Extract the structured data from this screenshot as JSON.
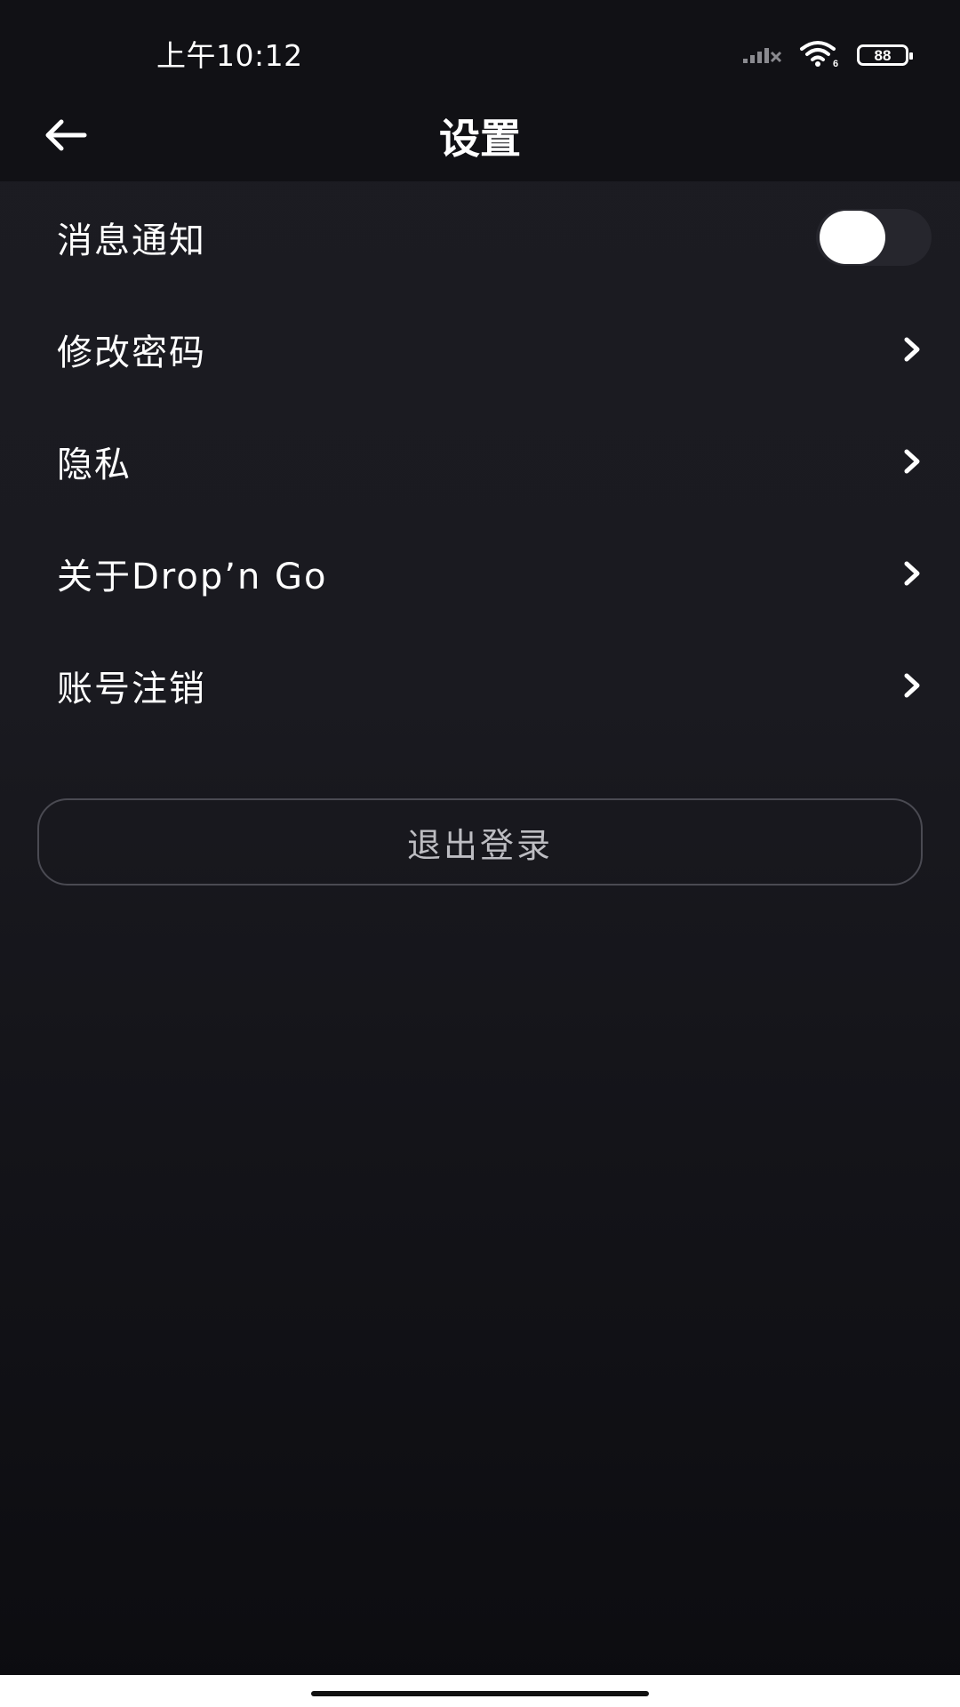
{
  "status_bar": {
    "time": "上午10:12",
    "battery": "88",
    "icons": [
      "signal-icon",
      "wifi-icon",
      "battery-icon"
    ]
  },
  "header": {
    "title": "设置",
    "back_icon": "arrow-left-icon"
  },
  "settings": {
    "items": [
      {
        "label": "消息通知",
        "control": "toggle",
        "enabled": false
      },
      {
        "label": "修改密码",
        "control": "chevron"
      },
      {
        "label": "隐私",
        "control": "chevron"
      },
      {
        "label": "关于Drop’n Go",
        "control": "chevron"
      },
      {
        "label": "账号注销",
        "control": "chevron"
      }
    ]
  },
  "logout": {
    "label": "退出登录"
  },
  "colors": {
    "background": "#1a1a20",
    "bar": "#111115",
    "text": "#ffffff",
    "logout_text": "#bdbdc2",
    "logout_border": "#4a4a52",
    "toggle_track": "#26262d"
  }
}
